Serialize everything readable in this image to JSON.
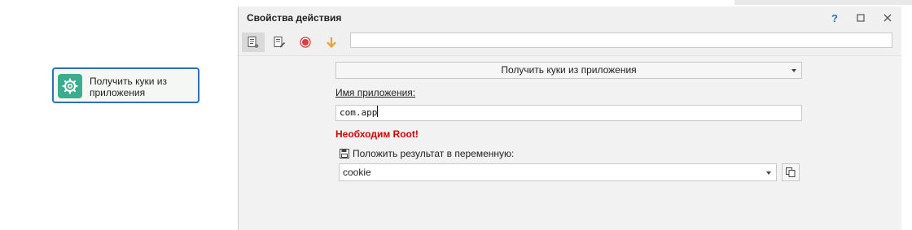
{
  "canvas": {
    "node": {
      "label": "Получить куки из приложения",
      "icon": "gear-icon",
      "accent": "#39ad8d",
      "border": "#2f6fb7"
    }
  },
  "window": {
    "title": "Свойства действия",
    "controls": {
      "help": "?",
      "maximize": "□",
      "close": "✕"
    },
    "toolbar": {
      "icons": [
        "properties-icon",
        "edit-icon",
        "record-icon",
        "arrow-down-icon"
      ],
      "input_value": ""
    },
    "action_select": {
      "value": "Получить куки из приложения"
    },
    "app_name": {
      "label": "Имя приложения:",
      "value": "com.app"
    },
    "warning": {
      "text": "Необходим Root!",
      "color": "#d40000"
    },
    "result": {
      "label": "Положить результат в переменную:",
      "icon": "save-icon",
      "variable": "cookie",
      "copy_icon": "copy-icon"
    }
  }
}
